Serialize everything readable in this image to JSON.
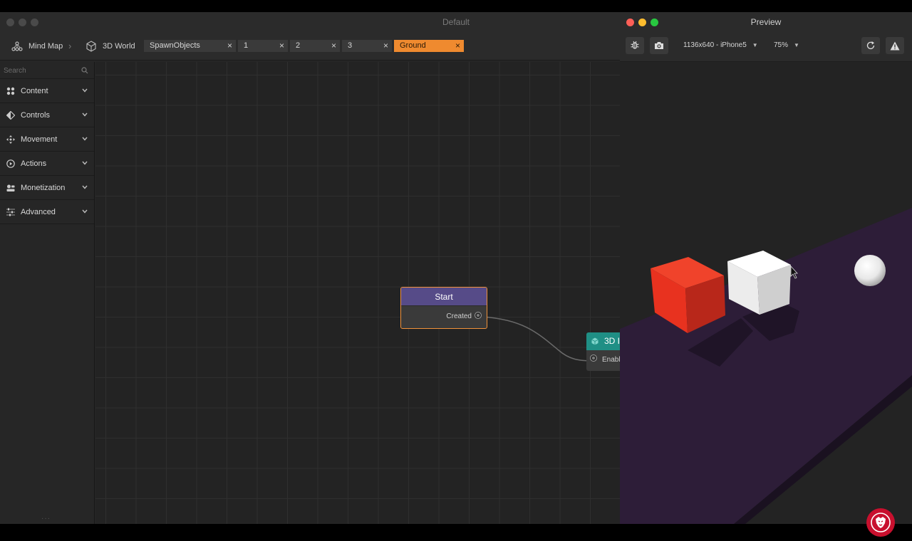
{
  "main_window": {
    "title": "Default"
  },
  "breadcrumbs": [
    {
      "label": "Mind Map",
      "icon": "mind-map-icon"
    },
    {
      "label": "3D World",
      "icon": "cube-icon"
    }
  ],
  "tabs": [
    {
      "label": "SpawnObjects",
      "close": "×",
      "active": false
    },
    {
      "label": "1",
      "close": "×",
      "active": false
    },
    {
      "label": "2",
      "close": "×",
      "active": false
    },
    {
      "label": "3",
      "close": "×",
      "active": false
    },
    {
      "label": "Ground",
      "close": "×",
      "active": true
    }
  ],
  "sidebar": {
    "search_placeholder": "Search",
    "categories": [
      {
        "label": "Content",
        "icon": "content-grid-icon"
      },
      {
        "label": "Controls",
        "icon": "controls-diamond-icon"
      },
      {
        "label": "Movement",
        "icon": "movement-arrows-icon"
      },
      {
        "label": "Actions",
        "icon": "actions-play-icon"
      },
      {
        "label": "Monetization",
        "icon": "monetization-icon"
      },
      {
        "label": "Advanced",
        "icon": "advanced-sliders-icon"
      }
    ]
  },
  "nodes": {
    "start": {
      "title": "Start",
      "output": "Created"
    },
    "three_d": {
      "title": "3D I",
      "input": "Enabl"
    }
  },
  "preview": {
    "title": "Preview",
    "device": "1136x640 - iPhone5",
    "zoom": "75%",
    "icons": [
      "bug-icon",
      "camera-icon",
      "refresh-icon",
      "warning-icon"
    ]
  },
  "colors": {
    "active_tab": "#ef8a2f",
    "start_node_header": "#564b88",
    "three_d_node_header": "#1f8f85",
    "ground": "#2d1d38",
    "red_cube": "#e8321f",
    "brand_badge": "#c8102e"
  }
}
